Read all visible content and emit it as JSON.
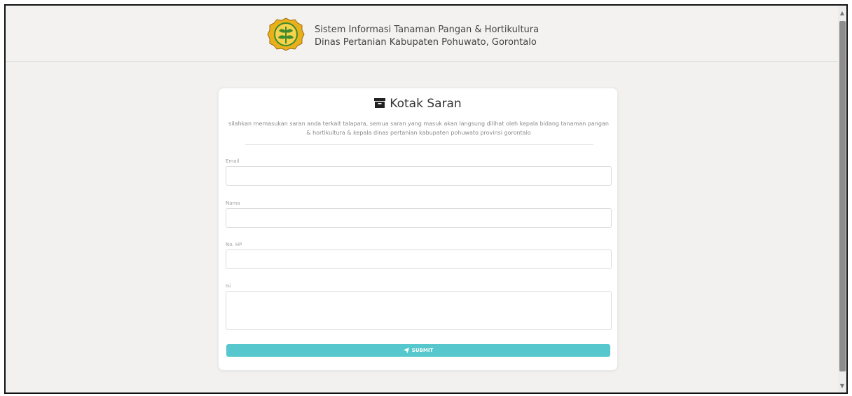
{
  "header": {
    "line1": "Sistem Informasi Tanaman Pangan & Hortikultura",
    "line2": "Dinas Pertanian Kabupaten Pohuwato, Gorontalo",
    "logo_icon": "regency-emblem-icon"
  },
  "form": {
    "title": "Kotak Saran",
    "title_icon": "archive-box-icon",
    "intro": "silahkan memasukan saran anda terkait talapara, semua saran yang masuk akan langsung dilihat oleh kepala bidang tanaman pangan & hortikultura & kepala dinas pertanian kabupaten pohuwato provinsi gorontalo",
    "fields": {
      "email": {
        "label": "Email",
        "value": "",
        "placeholder": ""
      },
      "nama": {
        "label": "Nama",
        "value": "",
        "placeholder": ""
      },
      "hp": {
        "label": "No. HP",
        "value": "",
        "placeholder": ""
      },
      "isi": {
        "label": "Isi",
        "value": "",
        "placeholder": ""
      }
    },
    "submit_label": "SUBMIT",
    "submit_icon": "paper-plane-icon"
  },
  "colors": {
    "background": "#f2f1ef",
    "card": "#ffffff",
    "accent": "#56c8cd",
    "logo_gold": "#e8b11b",
    "logo_green": "#3f8a2e"
  }
}
